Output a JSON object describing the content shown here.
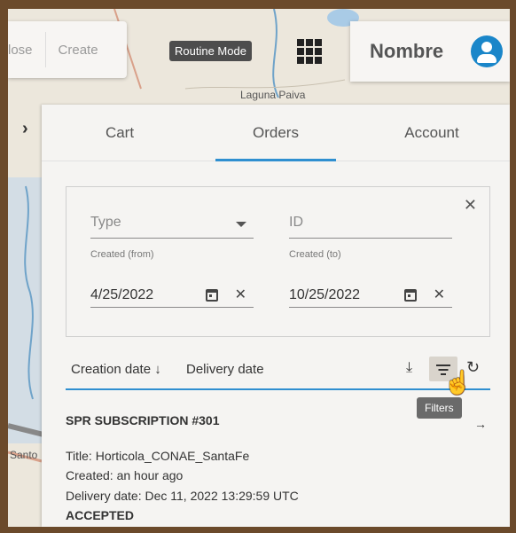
{
  "toolbar": {
    "close_label": "lose",
    "create_label": "Create",
    "mode_label": "Routine Mode",
    "user_name": "Nombre"
  },
  "map": {
    "labels": [
      "Laguna Paiva",
      "Santo"
    ]
  },
  "tabs": [
    {
      "label": "Cart",
      "active": false
    },
    {
      "label": "Orders",
      "active": true
    },
    {
      "label": "Account",
      "active": false
    }
  ],
  "filters": {
    "type_placeholder": "Type",
    "id_placeholder": "ID",
    "created_from_label": "Created (from)",
    "created_from_value": "4/25/2022",
    "created_to_label": "Created (to)",
    "created_to_value": "10/25/2022"
  },
  "sort": {
    "creation_label": "Creation date",
    "delivery_label": "Delivery date"
  },
  "tooltip": "Filters",
  "order": {
    "title": "SPR SUBSCRIPTION #301",
    "title_line": "Title: Horticola_CONAE_SantaFe",
    "created_line": "Created: an hour ago",
    "delivery_line": "Delivery date: Dec 11, 2022 13:29:59 UTC",
    "status": "ACCEPTED"
  },
  "colors": {
    "accent": "#2f8fd0",
    "avatar": "#1a86c9",
    "frame": "#6b4a2b"
  }
}
